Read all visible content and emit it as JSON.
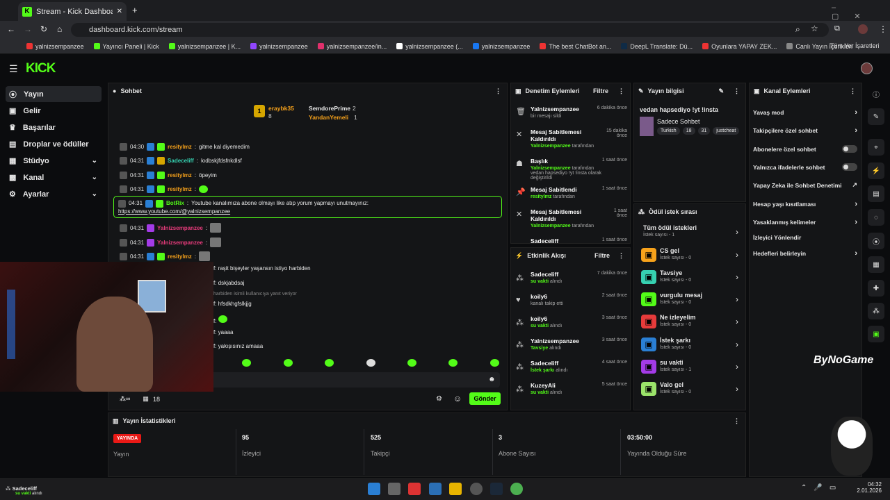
{
  "browser": {
    "tab_title": "Stream - Kick Dashboard",
    "url": "dashboard.kick.com/stream",
    "bookmarks": [
      "yalnizsempanzee",
      "Yayıncı Paneli | Kick",
      "yalnizsempanzee | K...",
      "yalnizsempanzee",
      "yalnizsempanzee/in...",
      "yalnizsempanzee (...",
      "yalnizsempanzee",
      "The best ChatBot an...",
      "DeepL Translate: Dü...",
      "Oyunlara YAPAY ZEK...",
      "Canlı Yayın İçerikleri"
    ],
    "all_bookmarks": "Tüm Yer İşaretleri"
  },
  "colors": {
    "accent": "#53fc18",
    "bg": "#0b0c0e",
    "panel": "#141517"
  },
  "nav": {
    "items": [
      {
        "label": "Yayın"
      },
      {
        "label": "Gelir"
      },
      {
        "label": "Başarılar"
      },
      {
        "label": "Droplar ve ödüller"
      },
      {
        "label": "Stüdyo"
      },
      {
        "label": "Kanal"
      },
      {
        "label": "Ayarlar"
      }
    ]
  },
  "chat": {
    "title": "Sohbet",
    "leaders": {
      "top1": "eraybk35",
      "top1_count": "8",
      "top2": "SemdorePrime",
      "top2_count": "2",
      "top3": "YandanYemeli",
      "top3_count": "1"
    },
    "lines": [
      {
        "time": "04:30",
        "user": "resitylmz",
        "msg": "gitme kal diyemedim"
      },
      {
        "time": "04:31",
        "user": "Sadeceliff",
        "msg": "kıdbskjfdsfnkdlsf"
      },
      {
        "time": "04:31",
        "user": "resitylmz",
        "msg": "öpeyim"
      },
      {
        "time": "04:31",
        "user": "resitylmz",
        "msg": ""
      }
    ],
    "bot": {
      "time": "04:31",
      "user": "BotRix",
      "msg": "Youtube kanalımıza abone olmayı like atıp yorum yapmayı unutmayınız:",
      "link": "https://www.youtube.com/@yalnizsempanzee"
    },
    "lines2": [
      {
        "time": "04:31",
        "user": "Yalnizsempanzee",
        "msg": ""
      },
      {
        "time": "04:31",
        "user": "Yalnizsempanzee",
        "msg": ""
      },
      {
        "time": "04:31",
        "user": "resitylmz",
        "msg": ""
      }
    ],
    "partial": [
      {
        "msg": "raşit bişeyler yaşansın istiyo harbiden"
      },
      {
        "msg": "dskjabdsaj"
      },
      {
        "msg": "harbiden isimli kullanıcıya yanıt veriyor"
      },
      {
        "msg": "hfsdkhgfslkjjg"
      },
      {
        "msg": "yaaaa"
      },
      {
        "msg": "yakışısınız amaaa"
      }
    ],
    "footer_count": "18",
    "send_label": "Gönder"
  },
  "moderation": {
    "title": "Denetim Eylemleri",
    "filter": "Filtre",
    "items": [
      {
        "title": "Yalnizsempanzee",
        "sub": "bir mesajı sildi",
        "time": "6 dakika önce"
      },
      {
        "title": "Mesaj Sabitlemesi Kaldırıldı",
        "by": "Yalnizsempanzee",
        "sub": "tarafından",
        "time": "15 dakika önce"
      },
      {
        "title": "Başlık",
        "by": "Yalnizsempanzee",
        "sub": "tarafından vedan hapsediyo !yt !insta olarak değiştirildi",
        "time": "1 saat önce"
      },
      {
        "title": "Mesaj Sabitlendi",
        "by": "resitylmz",
        "sub": "tarafından",
        "time": "1 saat önce"
      },
      {
        "title": "Mesaj Sabitlemesi Kaldırıldı",
        "by": "Yalnizsempanzee",
        "sub": "tarafından",
        "time": "1 saat önce"
      },
      {
        "title": "Sadeceliff",
        "sub": "",
        "time": "1 saat önce"
      }
    ]
  },
  "activity": {
    "title": "Etkinlik Akışı",
    "filter": "Filtre",
    "items": [
      {
        "user": "Sadeceliff",
        "hl": "su vakti",
        "sub": "alındı",
        "time": "7 dakika önce"
      },
      {
        "user": "koily6",
        "hl": "",
        "sub": "kanalı takip etti",
        "time": "2 saat önce"
      },
      {
        "user": "koily6",
        "hl": "su vakti",
        "sub": "alındı",
        "time": "3 saat önce"
      },
      {
        "user": "Yalnizsempanzee",
        "hl": "Tavsiye",
        "sub": "alındı",
        "time": "3 saat önce"
      },
      {
        "user": "Sadeceliff",
        "hl": "İstek şarkı",
        "sub": "alındı",
        "time": "4 saat önce"
      },
      {
        "user": "KuzeyAli",
        "hl": "su vakti",
        "sub": "alındı",
        "time": "5 saat önce"
      }
    ]
  },
  "stream_info": {
    "title": "Yayın bilgisi",
    "stream_title": "vedan hapsediyo !yt !insta",
    "category": "Sadece Sohbet",
    "tags": [
      "Turkish",
      "18",
      "31",
      "justcheat"
    ]
  },
  "rewards": {
    "title": "Ödül istek sırası",
    "items": [
      {
        "name": "Tüm ödül istekleri",
        "sub": "İstek sayısı - 1",
        "color": ""
      },
      {
        "name": "CS gel",
        "sub": "İstek sayısı - 0",
        "color": "#f7a21b"
      },
      {
        "name": "Tavsiye",
        "sub": "İstek sayısı - 0",
        "color": "#36d1b1"
      },
      {
        "name": "vurgulu mesaj",
        "sub": "İstek sayısı - 0",
        "color": "#53fc18"
      },
      {
        "name": "Ne izleyelim",
        "sub": "İstek sayısı - 0",
        "color": "#e73b3b"
      },
      {
        "name": "İstek şarkı",
        "sub": "İstek sayısı - 0",
        "color": "#2a7fd4"
      },
      {
        "name": "su vakti",
        "sub": "İstek sayısı - 1",
        "color": "#a43be7"
      },
      {
        "name": "Valo gel",
        "sub": "İstek sayısı - 0",
        "color": "#9be36a"
      }
    ]
  },
  "channel_actions": {
    "title": "Kanal Eylemleri",
    "items": [
      {
        "label": "Yavaş mod",
        "kind": "chev"
      },
      {
        "label": "Takipçilere özel sohbet",
        "kind": "chev"
      },
      {
        "label": "Abonelere özel sohbet",
        "kind": "toggle"
      },
      {
        "label": "Yalnızca ifadelerle sohbet",
        "kind": "toggle"
      },
      {
        "label": "Yapay Zeka ile Sohbet Denetimi",
        "kind": "ext"
      },
      {
        "label": "Hesap yaşı kısıtlaması",
        "kind": "chev"
      },
      {
        "label": "Yasaklanmış kelimeler",
        "kind": "chev"
      },
      {
        "label": "İzleyici Yönlendir",
        "kind": "none"
      },
      {
        "label": "Hedefleri belirleyin",
        "kind": "chev"
      }
    ]
  },
  "stats": {
    "title": "Yayın İstatistikleri",
    "live_badge": "YAYINDA",
    "live_label": "Yayın",
    "items": [
      {
        "value": "95",
        "label": "İzleyici"
      },
      {
        "value": "525",
        "label": "Takipçi"
      },
      {
        "value": "3",
        "label": "Abone Sayısı"
      },
      {
        "value": "03:50:00",
        "label": "Yayında Olduğu Süre"
      }
    ]
  },
  "overlay": {
    "watermark": "ByNoGame"
  },
  "notification": {
    "user": "Sadeceliff",
    "hl": "su vakti",
    "sub": "alındı"
  },
  "taskbar": {
    "time": "04:32",
    "date": "2.01.2026"
  }
}
